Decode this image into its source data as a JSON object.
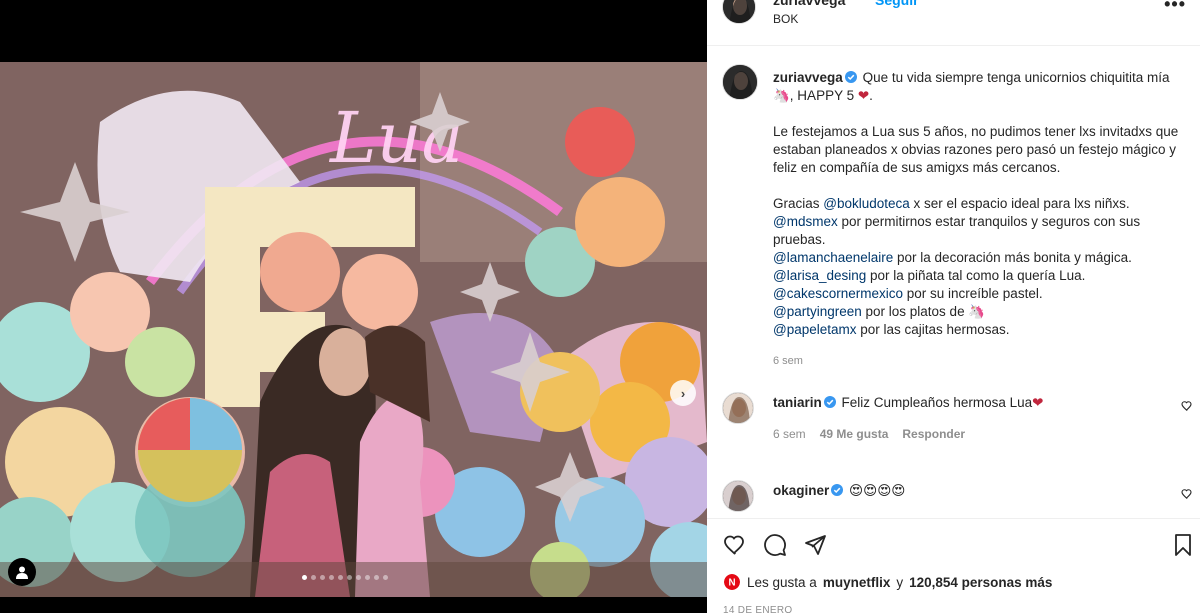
{
  "post": {
    "username": "zuriavvega",
    "follow_label": "Seguir",
    "location": "BOK",
    "more_label": "•••"
  },
  "caption": {
    "username": "zuriavvega",
    "line1": "Que tu vida siempre tenga unicornios chiquitita mía",
    "line1_end": "🦄, HAPPY 5",
    "heart": "❤",
    "para2": "Le festejamos a Lua sus 5 años, no pudimos tener lxs invitadxs que estaban planeados x obvias razones pero pasó un festejo mágico y feliz en compañía de sus amigxs más cercanos.",
    "thanks": [
      {
        "prefix": "Gracias ",
        "mention": "@bokludoteca",
        "text": " x ser el espacio ideal para lxs niñxs."
      },
      {
        "prefix": "",
        "mention": "@mdsmex",
        "text": " por permitirnos estar tranquilos y seguros con sus pruebas."
      },
      {
        "prefix": "",
        "mention": "@lamanchaenelaire",
        "text": " por la decoración más bonita y mágica."
      },
      {
        "prefix": "",
        "mention": "@larisa_desing",
        "text": " por la piñata tal como la quería Lua."
      },
      {
        "prefix": "",
        "mention": "@cakescornermexico",
        "text": " por su increíble pastel."
      },
      {
        "prefix": "",
        "mention": "@partyingreen",
        "text": " por los platos de 🦄"
      },
      {
        "prefix": "",
        "mention": "@papeletamx",
        "text": " por las cajitas hermosas."
      }
    ],
    "time": "6 sem"
  },
  "comments": [
    {
      "username": "taniarin",
      "text": "Feliz Cumpleaños hermosa Lua",
      "heart": "❤",
      "time": "6 sem",
      "likes": "49 Me gusta",
      "reply": "Responder"
    },
    {
      "username": "okaginer",
      "text": "😍😍😍😍",
      "heart": "",
      "time": "",
      "likes": "",
      "reply": ""
    }
  ],
  "likes": {
    "prefix": "Les gusta a",
    "user": "muynetflix",
    "middle": "y",
    "count": "120,854 personas más"
  },
  "date": "14 DE ENERO",
  "carousel": {
    "total": 10,
    "active": 0
  },
  "colors": {
    "accent": "#0095f6",
    "mention": "#00376b",
    "verified": "#3897f0",
    "meta": "#8e8e8e"
  }
}
